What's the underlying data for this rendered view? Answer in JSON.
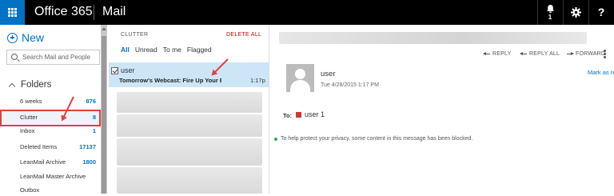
{
  "topbar": {
    "brand": "Office 365",
    "app": "Mail",
    "notification_count": "1",
    "help_glyph": "?",
    "icons": [
      "app-launcher-icon",
      "bell-icon",
      "gear-icon",
      "help-icon"
    ]
  },
  "colors": {
    "accent": "#0072c6",
    "topbar": "#000000",
    "highlight_border": "#e0413a",
    "selected_row": "#cde6f7",
    "delete_all": "#cc0000"
  },
  "left": {
    "new_label": "New",
    "search_placeholder": "Search Mail and People",
    "folders_heading": "Folders",
    "folders": [
      {
        "name": "6 weeks",
        "count": "876"
      },
      {
        "name": "Clutter",
        "count": "8"
      },
      {
        "name": "Inbox",
        "count": "1"
      },
      {
        "name": "Deleted Items",
        "count": "17137"
      },
      {
        "name": "LeanMail Archive",
        "count": "1800"
      },
      {
        "name": "LeanMail Master Archive",
        "count": ""
      },
      {
        "name": "Outbox",
        "count": ""
      }
    ]
  },
  "list": {
    "folder_label": "CLUTTER",
    "delete_all": "DELETE ALL",
    "filters": [
      "All",
      "Unread",
      "To me",
      "Flagged"
    ],
    "active_filter": "All",
    "selected_message": {
      "sender": "user",
      "subject": "Tomorrow's Webcast: Fire Up Your E",
      "time": "1:17p"
    }
  },
  "reading": {
    "actions": [
      "REPLY",
      "REPLY ALL",
      "FORWARD"
    ],
    "from_name": "user",
    "date": "Tue 4/28/2015 1:17 PM",
    "mark_read": "Mark as re",
    "to_label": "To:",
    "to_name": "user 1",
    "blocked_notice": "To help protect your privacy, some content in this message has been blocked."
  }
}
